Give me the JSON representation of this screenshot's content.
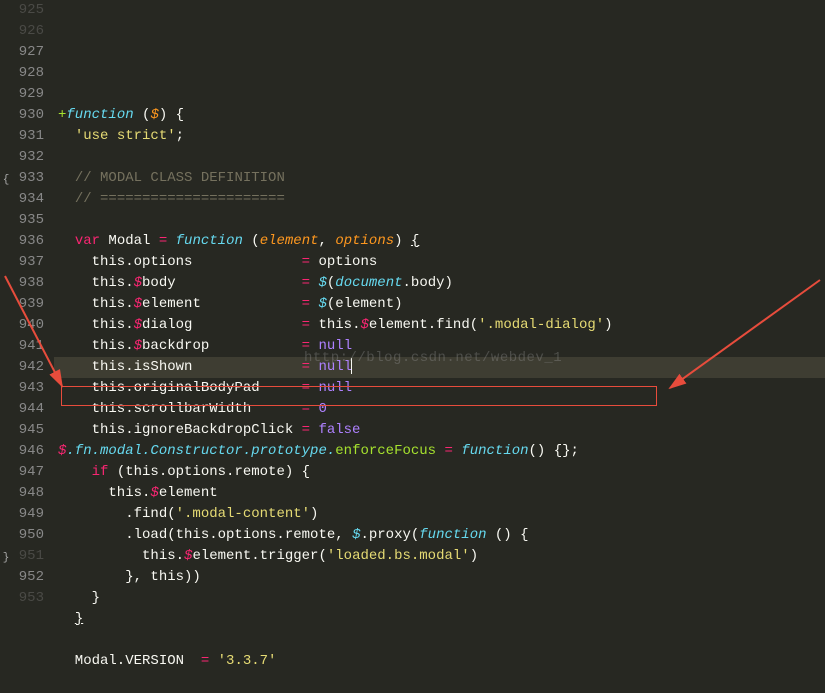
{
  "watermark": "http://blog.csdn.net/webdev_1",
  "startLine": 925,
  "highlightedLineIndex": 14,
  "foldOpen": [
    8,
    26
  ],
  "foldClose": [
    26
  ],
  "dimLines": [
    0,
    1,
    26,
    28
  ],
  "lines": [
    {
      "tokens": [
        {
          "t": "    ",
          "c": ""
        }
      ]
    },
    {
      "tokens": [
        {
          "t": "+",
          "c": "c-diff"
        },
        {
          "t": "function",
          "c": "c-func"
        },
        {
          "t": " (",
          "c": ""
        },
        {
          "t": "$",
          "c": "c-param"
        },
        {
          "t": ") {",
          "c": ""
        }
      ]
    },
    {
      "tokens": [
        {
          "t": "  ",
          "c": ""
        },
        {
          "t": "'use strict'",
          "c": "c-string"
        },
        {
          "t": ";",
          "c": ""
        }
      ]
    },
    {
      "tokens": []
    },
    {
      "tokens": [
        {
          "t": "  ",
          "c": ""
        },
        {
          "t": "// MODAL CLASS DEFINITION",
          "c": "c-comment"
        }
      ]
    },
    {
      "tokens": [
        {
          "t": "  ",
          "c": ""
        },
        {
          "t": "// ======================",
          "c": "c-comment"
        }
      ]
    },
    {
      "tokens": []
    },
    {
      "tokens": [
        {
          "t": "  ",
          "c": ""
        },
        {
          "t": "var",
          "c": "c-keyword2"
        },
        {
          "t": " Modal ",
          "c": ""
        },
        {
          "t": "=",
          "c": "c-keyword2"
        },
        {
          "t": " ",
          "c": ""
        },
        {
          "t": "function",
          "c": "c-func"
        },
        {
          "t": " (",
          "c": ""
        },
        {
          "t": "element",
          "c": "c-param"
        },
        {
          "t": ", ",
          "c": ""
        },
        {
          "t": "options",
          "c": "c-param"
        },
        {
          "t": ") ",
          "c": ""
        },
        {
          "t": "{",
          "c": "c-brace"
        }
      ]
    },
    {
      "tokens": [
        {
          "t": "    this.options             ",
          "c": ""
        },
        {
          "t": "=",
          "c": "c-keyword2"
        },
        {
          "t": " options",
          "c": ""
        }
      ]
    },
    {
      "tokens": [
        {
          "t": "    this.",
          "c": ""
        },
        {
          "t": "$",
          "c": "c-dollar"
        },
        {
          "t": "body               ",
          "c": ""
        },
        {
          "t": "=",
          "c": "c-keyword2"
        },
        {
          "t": " ",
          "c": ""
        },
        {
          "t": "$",
          "c": "c-var"
        },
        {
          "t": "(",
          "c": ""
        },
        {
          "t": "document",
          "c": "c-doc"
        },
        {
          "t": ".body)",
          "c": ""
        }
      ]
    },
    {
      "tokens": [
        {
          "t": "    this.",
          "c": ""
        },
        {
          "t": "$",
          "c": "c-dollar"
        },
        {
          "t": "element            ",
          "c": ""
        },
        {
          "t": "=",
          "c": "c-keyword2"
        },
        {
          "t": " ",
          "c": ""
        },
        {
          "t": "$",
          "c": "c-var"
        },
        {
          "t": "(element)",
          "c": ""
        }
      ]
    },
    {
      "tokens": [
        {
          "t": "    this.",
          "c": ""
        },
        {
          "t": "$",
          "c": "c-dollar"
        },
        {
          "t": "dialog             ",
          "c": ""
        },
        {
          "t": "=",
          "c": "c-keyword2"
        },
        {
          "t": " this.",
          "c": ""
        },
        {
          "t": "$",
          "c": "c-dollar"
        },
        {
          "t": "element.find(",
          "c": ""
        },
        {
          "t": "'.modal-dialog'",
          "c": "c-string"
        },
        {
          "t": ")",
          "c": ""
        }
      ]
    },
    {
      "tokens": [
        {
          "t": "    this.",
          "c": ""
        },
        {
          "t": "$",
          "c": "c-dollar"
        },
        {
          "t": "backdrop           ",
          "c": ""
        },
        {
          "t": "=",
          "c": "c-keyword2"
        },
        {
          "t": " ",
          "c": ""
        },
        {
          "t": "null",
          "c": "c-null"
        }
      ]
    },
    {
      "tokens": [
        {
          "t": "    this.isShown             ",
          "c": ""
        },
        {
          "t": "=",
          "c": "c-keyword2"
        },
        {
          "t": " ",
          "c": ""
        },
        {
          "t": "null",
          "c": "c-null"
        },
        {
          "t": "",
          "c": "cursor"
        }
      ]
    },
    {
      "tokens": [
        {
          "t": "    this.originalBodyPad     ",
          "c": ""
        },
        {
          "t": "=",
          "c": "c-keyword2"
        },
        {
          "t": " ",
          "c": ""
        },
        {
          "t": "null",
          "c": "c-null"
        }
      ]
    },
    {
      "tokens": [
        {
          "t": "    this.scrollbarWidth      ",
          "c": ""
        },
        {
          "t": "=",
          "c": "c-keyword2"
        },
        {
          "t": " ",
          "c": ""
        },
        {
          "t": "0",
          "c": "c-const"
        }
      ]
    },
    {
      "tokens": [
        {
          "t": "    this.ignoreBackdropClick ",
          "c": ""
        },
        {
          "t": "=",
          "c": "c-keyword2"
        },
        {
          "t": " ",
          "c": ""
        },
        {
          "t": "false",
          "c": "c-null"
        }
      ]
    },
    {
      "tokens": [
        {
          "t": "$",
          "c": "c-dollar"
        },
        {
          "t": ".fn.modal.",
          "c": "c-var"
        },
        {
          "t": "Constructor",
          "c": "c-var"
        },
        {
          "t": ".prototype.",
          "c": "c-var"
        },
        {
          "t": "enforceFocus",
          "c": "c-method"
        },
        {
          "t": " ",
          "c": ""
        },
        {
          "t": "=",
          "c": "c-keyword2"
        },
        {
          "t": " ",
          "c": ""
        },
        {
          "t": "function",
          "c": "c-func"
        },
        {
          "t": "() {};",
          "c": ""
        }
      ]
    },
    {
      "tokens": [
        {
          "t": "    ",
          "c": ""
        },
        {
          "t": "if",
          "c": "c-keyword2"
        },
        {
          "t": " (this.options.remote) {",
          "c": ""
        }
      ]
    },
    {
      "tokens": [
        {
          "t": "      this.",
          "c": ""
        },
        {
          "t": "$",
          "c": "c-dollar"
        },
        {
          "t": "element",
          "c": ""
        }
      ]
    },
    {
      "tokens": [
        {
          "t": "        .find(",
          "c": ""
        },
        {
          "t": "'.modal-content'",
          "c": "c-string"
        },
        {
          "t": ")",
          "c": ""
        }
      ]
    },
    {
      "tokens": [
        {
          "t": "        .load(this.options.remote, ",
          "c": ""
        },
        {
          "t": "$",
          "c": "c-var"
        },
        {
          "t": ".proxy(",
          "c": ""
        },
        {
          "t": "function",
          "c": "c-func"
        },
        {
          "t": " () {",
          "c": ""
        }
      ]
    },
    {
      "tokens": [
        {
          "t": "          this.",
          "c": ""
        },
        {
          "t": "$",
          "c": "c-dollar"
        },
        {
          "t": "element.trigger(",
          "c": ""
        },
        {
          "t": "'loaded.bs.modal'",
          "c": "c-string"
        },
        {
          "t": ")",
          "c": ""
        }
      ]
    },
    {
      "tokens": [
        {
          "t": "        }, this))",
          "c": ""
        }
      ]
    },
    {
      "tokens": [
        {
          "t": "    }",
          "c": ""
        }
      ]
    },
    {
      "tokens": [
        {
          "t": "  ",
          "c": ""
        },
        {
          "t": "}",
          "c": "c-brace"
        }
      ]
    },
    {
      "tokens": []
    },
    {
      "tokens": [
        {
          "t": "  Modal.VERSION  ",
          "c": ""
        },
        {
          "t": "=",
          "c": "c-keyword2"
        },
        {
          "t": " ",
          "c": ""
        },
        {
          "t": "'3.3.7'",
          "c": "c-string"
        }
      ]
    },
    {
      "tokens": []
    }
  ]
}
